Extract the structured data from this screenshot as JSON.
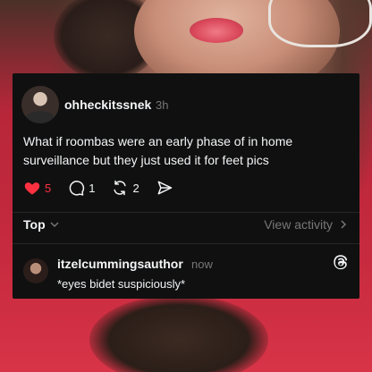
{
  "post": {
    "username": "ohheckitssnek",
    "time": "3h",
    "text": "What if roombas were an early phase of in home surveillance but they just used it for feet pics",
    "likes": "5",
    "comments": "1",
    "reposts": "2"
  },
  "filter": {
    "sort_label": "Top",
    "view_activity_label": "View activity"
  },
  "reply": {
    "username": "itzelcummingsauthor",
    "time": "now",
    "text": "*eyes bidet suspiciously*"
  },
  "colors": {
    "card_bg": "#101010",
    "like": "#ff3040",
    "muted": "#777777"
  },
  "icons": [
    "heart-icon",
    "comment-icon",
    "repost-icon",
    "share-icon",
    "chevron-down-icon",
    "chevron-right-icon",
    "threads-logo-icon"
  ]
}
